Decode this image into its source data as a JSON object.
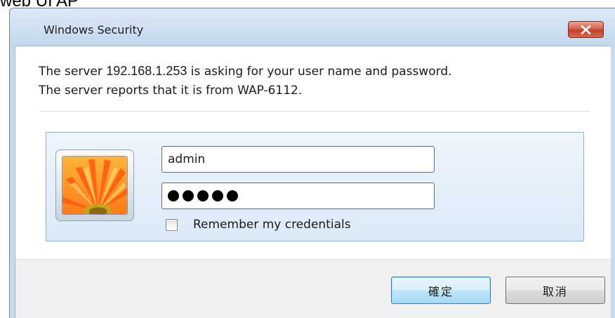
{
  "background": {
    "partial_text": "web UI AP"
  },
  "window": {
    "title": "Windows Security",
    "close_icon": "close-x-icon"
  },
  "message": {
    "line1_prefix": "The server ",
    "host": "192.168.1.253",
    "line1_suffix": " is asking for your user name and password.",
    "line2": "The server reports that it is from WAP-6112."
  },
  "credentials": {
    "avatar_icon": "user-tile-flower-icon",
    "username": "admin",
    "password_mask_count": 5,
    "remember_label": "Remember my credentials",
    "remember_checked": false
  },
  "buttons": {
    "ok_label": "確定",
    "cancel_label": "取消"
  },
  "colors": {
    "close_button": "#c2402a",
    "ok_button_border": "#3c7fb1",
    "panel_border": "#90b2d4"
  }
}
